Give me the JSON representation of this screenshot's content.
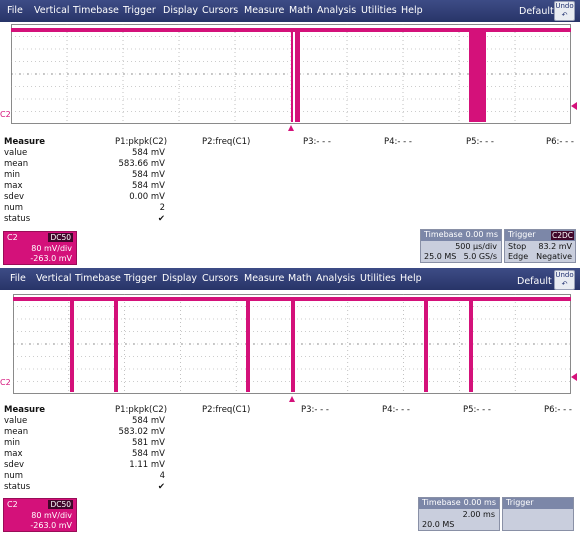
{
  "menu": [
    "File",
    "Vertical",
    "Timebase",
    "Trigger",
    "Display",
    "Cursors",
    "Measure",
    "Math",
    "Analysis",
    "Utilities",
    "Help"
  ],
  "default_label": "Default",
  "undo_label": "Undo",
  "colors": {
    "trace": "#d4117a",
    "menubar": "#2f3c74",
    "grid": "#9a9a9a"
  },
  "scope1": {
    "channel_marker": "C2",
    "measure": {
      "title": "Measure",
      "columns": [
        "P1:pkpk(C2)",
        "P2:freq(C1)",
        "P3:- - -",
        "P4:- - -",
        "P5:- - -",
        "P6:- - -"
      ],
      "rows": [
        {
          "label": "value",
          "p1": "584 mV"
        },
        {
          "label": "mean",
          "p1": "583.66 mV"
        },
        {
          "label": "min",
          "p1": "584 mV"
        },
        {
          "label": "max",
          "p1": "584 mV"
        },
        {
          "label": "sdev",
          "p1": "0.00 mV"
        },
        {
          "label": "num",
          "p1": "2"
        },
        {
          "label": "status",
          "p1": "✔"
        }
      ]
    },
    "c2": {
      "title": "C2",
      "coupling": "DC50",
      "vdiv": "80 mV/div",
      "offset": "-263.0 mV"
    },
    "timebase": {
      "title": "Timebase",
      "delay": "0.00 ms",
      "tdiv": "500 µs/div",
      "samples": "25.0 MS",
      "rate": "5.0 GS/s"
    },
    "trigger": {
      "title": "Trigger",
      "source": "C2",
      "coupling": "DC",
      "mode": "Stop",
      "level": "83.2 mV",
      "type": "Edge",
      "slope": "Negative"
    }
  },
  "scope2": {
    "channel_marker": "C2",
    "measure": {
      "title": "Measure",
      "columns": [
        "P1:pkpk(C2)",
        "P2:freq(C1)",
        "P3:- - -",
        "P4:- - -",
        "P5:- - -",
        "P6:- - -"
      ],
      "rows": [
        {
          "label": "value",
          "p1": "584 mV"
        },
        {
          "label": "mean",
          "p1": "583.02 mV"
        },
        {
          "label": "min",
          "p1": "581 mV"
        },
        {
          "label": "max",
          "p1": "584 mV"
        },
        {
          "label": "sdev",
          "p1": "1.11 mV"
        },
        {
          "label": "num",
          "p1": "4"
        },
        {
          "label": "status",
          "p1": "✔"
        }
      ]
    },
    "c2": {
      "title": "C2",
      "coupling": "DC50",
      "vdiv": "80 mV/div",
      "offset": "-263.0 mV"
    },
    "timebase": {
      "title": "Timebase",
      "delay": "0.00 ms",
      "tdiv": "2.00 ms",
      "samples": "20.0 MS"
    },
    "trigger": {
      "title": "Trigger"
    }
  }
}
